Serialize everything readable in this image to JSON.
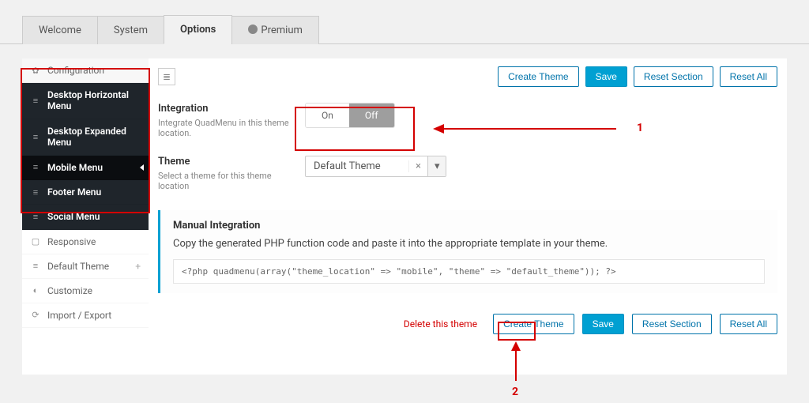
{
  "tabs": {
    "welcome": "Welcome",
    "system": "System",
    "options": "Options",
    "premium": "Premium"
  },
  "sidebar": {
    "configuration": "Configuration",
    "dark": [
      "Desktop Horizontal Menu",
      "Desktop Expanded Menu",
      "Mobile Menu",
      "Footer Menu",
      "Social Menu"
    ],
    "responsive": "Responsive",
    "default_theme": "Default Theme",
    "customize": "Customize",
    "import_export": "Import / Export"
  },
  "toolbar": {
    "create_theme": "Create Theme",
    "save": "Save",
    "reset_section": "Reset Section",
    "reset_all": "Reset All"
  },
  "integration": {
    "title": "Integration",
    "desc": "Integrate QuadMenu in this theme location.",
    "on": "On",
    "off": "Off"
  },
  "theme": {
    "title": "Theme",
    "desc": "Select a theme for this theme location",
    "value": "Default Theme"
  },
  "manual": {
    "title": "Manual Integration",
    "desc": "Copy the generated PHP function code and paste it into the appropriate template in your theme.",
    "code": "<?php quadmenu(array(\"theme_location\" => \"mobile\", \"theme\" => \"default_theme\")); ?>"
  },
  "footer": {
    "delete": "Delete this theme"
  },
  "annotations": {
    "one": "1",
    "two": "2"
  }
}
